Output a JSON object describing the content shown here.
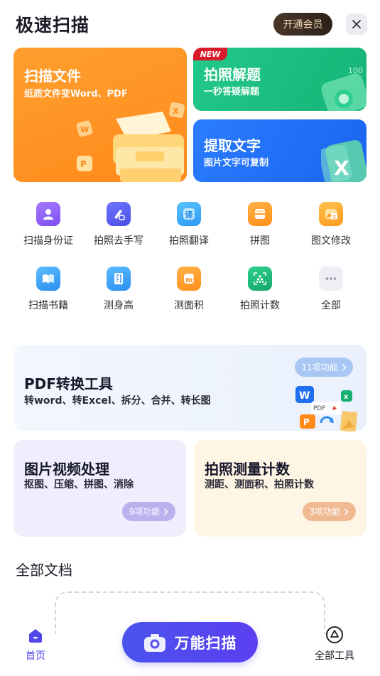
{
  "header": {
    "title": "极速扫描",
    "vip_label": "开通会员"
  },
  "hero": {
    "scan": {
      "title": "扫描文件",
      "subtitle": "纸质文件变Word、PDF"
    },
    "solve": {
      "badge": "NEW",
      "title": "拍照解题",
      "subtitle": "一秒答疑解题"
    },
    "text": {
      "title": "提取文字",
      "subtitle": "图片文字可复制"
    }
  },
  "tools": [
    {
      "label": "扫描身份证",
      "icon": "id-card-icon",
      "color": "#8a5cf6"
    },
    {
      "label": "拍照去手写",
      "icon": "eraser-pen-icon",
      "color": "#5b5df0"
    },
    {
      "label": "拍照翻译",
      "icon": "translate-icon",
      "color": "#2fa7f5"
    },
    {
      "label": "拼图",
      "icon": "collage-icon",
      "color": "#ff9a1f"
    },
    {
      "label": "图文修改",
      "icon": "image-text-edit-icon",
      "color": "#ffa020"
    },
    {
      "label": "扫描书籍",
      "icon": "book-icon",
      "color": "#2f9cf5"
    },
    {
      "label": "测身高",
      "icon": "height-ruler-icon",
      "color": "#2f9cf5"
    },
    {
      "label": "测面积",
      "icon": "area-measure-icon",
      "color": "#ff9a1f"
    },
    {
      "label": "拍照计数",
      "icon": "count-dots-icon",
      "color": "#19b67a"
    },
    {
      "label": "全部",
      "icon": "more-dots-icon",
      "color": "#a7a7b8"
    }
  ],
  "pdf_tool": {
    "title": "PDF转换工具",
    "subtitle": "转word、转Excel、拆分、合并、转长图",
    "count_label": "11项功能",
    "pdf_text": "PDF"
  },
  "media_tool": {
    "title": "图片视频处理",
    "subtitle": "抠图、压缩、拼图、消除",
    "count_label": "9项功能"
  },
  "measure_tool": {
    "title": "拍照测量计数",
    "subtitle": "测距、测面积、拍照计数",
    "count_label": "3项功能"
  },
  "documents": {
    "title": "全部文档"
  },
  "nav": {
    "home_label": "首页",
    "scan_label": "万能扫描",
    "tools_label": "全部工具"
  }
}
